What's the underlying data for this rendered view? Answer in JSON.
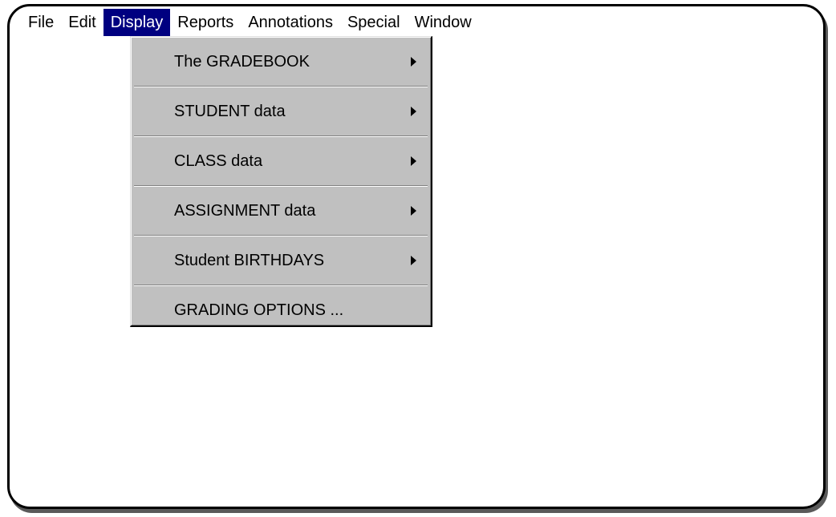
{
  "menubar": {
    "items": [
      {
        "label": "File"
      },
      {
        "label": "Edit"
      },
      {
        "label": "Display"
      },
      {
        "label": "Reports"
      },
      {
        "label": "Annotations"
      },
      {
        "label": "Special"
      },
      {
        "label": "Window"
      }
    ],
    "active_item": "Display"
  },
  "display_menu": {
    "items": [
      {
        "label": "The GRADEBOOK",
        "submenu": true
      },
      {
        "label": "STUDENT data",
        "submenu": true
      },
      {
        "label": "CLASS data",
        "submenu": true
      },
      {
        "label": "ASSIGNMENT data",
        "submenu": true
      },
      {
        "label": "Student BIRTHDAYS",
        "submenu": true
      },
      {
        "label": "GRADING OPTIONS ...",
        "submenu": false
      }
    ]
  },
  "colors": {
    "highlight": "#000080",
    "menu_background": "#c0c0c0",
    "window_background": "#ffffff"
  }
}
